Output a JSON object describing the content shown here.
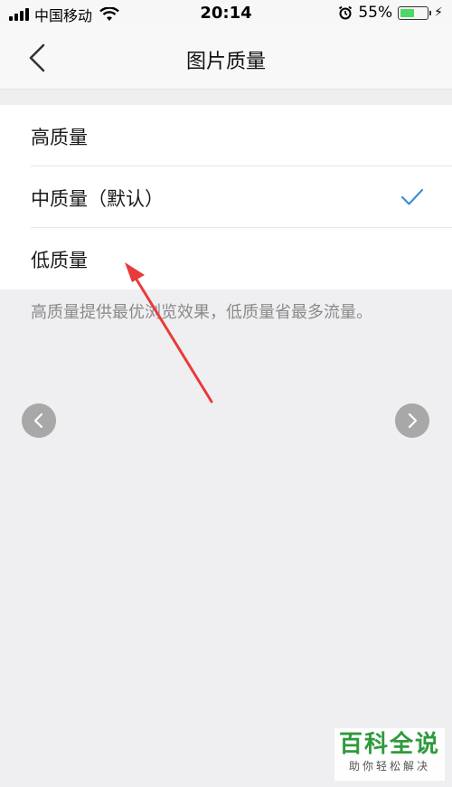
{
  "status_bar": {
    "carrier": "中国移动",
    "time": "20:14",
    "battery_percent": "55%",
    "battery_level": 0.55
  },
  "nav": {
    "title": "图片质量",
    "back_icon": "chevron-left-icon"
  },
  "options": [
    {
      "label": "高质量",
      "selected": false
    },
    {
      "label": "中质量（默认）",
      "selected": true
    },
    {
      "label": "低质量",
      "selected": false
    }
  ],
  "description": "高质量提供最优浏览效果，低质量省最多流量。",
  "colors": {
    "accent": "#3e8ed8",
    "annotation_arrow": "#e83a3a",
    "background": "#efeff1"
  },
  "watermark": {
    "title": "百科全说",
    "subtitle": "助你轻松解决"
  }
}
